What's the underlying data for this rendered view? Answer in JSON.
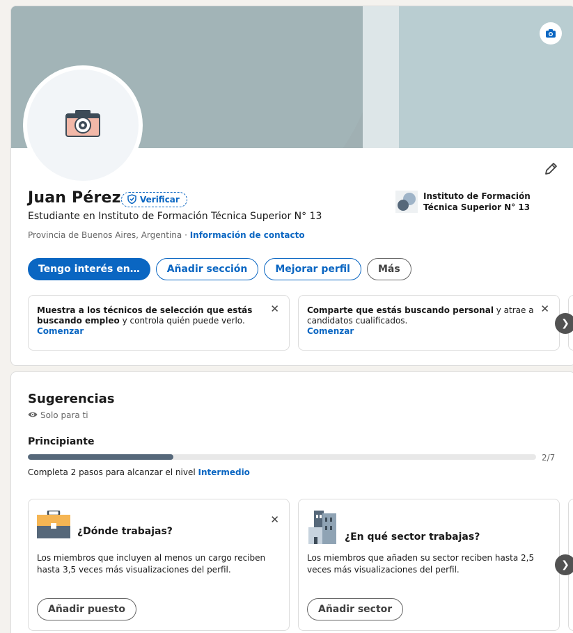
{
  "profile": {
    "name": "Juan Pérez",
    "verify_label": "Verificar",
    "headline": "Estudiante en Instituto de Formación Técnica Superior N° 13",
    "location": "Provincia de Buenos Aires, Argentina",
    "separator": " · ",
    "contact_link": "Información de contacto",
    "institution": "Instituto de Formación Técnica Superior N° 13",
    "actions": {
      "interest": "Tengo interés en…",
      "add_section": "Añadir sección",
      "improve": "Mejorar perfil",
      "more": "Más"
    },
    "tips": [
      {
        "bold": "Muestra a los técnicos de selección que estás buscando empleo",
        "text": " y controla quién puede verlo.",
        "cta": "Comenzar"
      },
      {
        "bold": "Comparte que estás buscando personal",
        "text": " y atrae a candidatos cualificados.",
        "cta": "Comenzar"
      }
    ],
    "close_glyph": "✕",
    "next_glyph": "❯"
  },
  "suggestions": {
    "title": "Sugerencias",
    "private": "Solo para ti",
    "level": "Principiante",
    "progress_fraction": 0.2857,
    "progress_text": "2/7",
    "next_level_prefix": "Completa 2 pasos para alcanzar el nivel ",
    "next_level_link": "Intermedio",
    "cards": [
      {
        "title": "¿Dónde trabajas?",
        "body": "Los miembros que incluyen al menos un cargo reciben hasta 3,5 veces más visualizaciones del perfil.",
        "button": "Añadir puesto",
        "icon": "briefcase-icon"
      },
      {
        "title": "¿En qué sector trabajas?",
        "body": "Los miembros que añaden su sector reciben hasta 2,5 veces más visualizaciones del perfil.",
        "button": "Añadir sector",
        "icon": "buildings-icon"
      }
    ]
  },
  "colors": {
    "accent": "#0a66c2",
    "cover": "#a0b0b3",
    "progress": "#56687a"
  }
}
